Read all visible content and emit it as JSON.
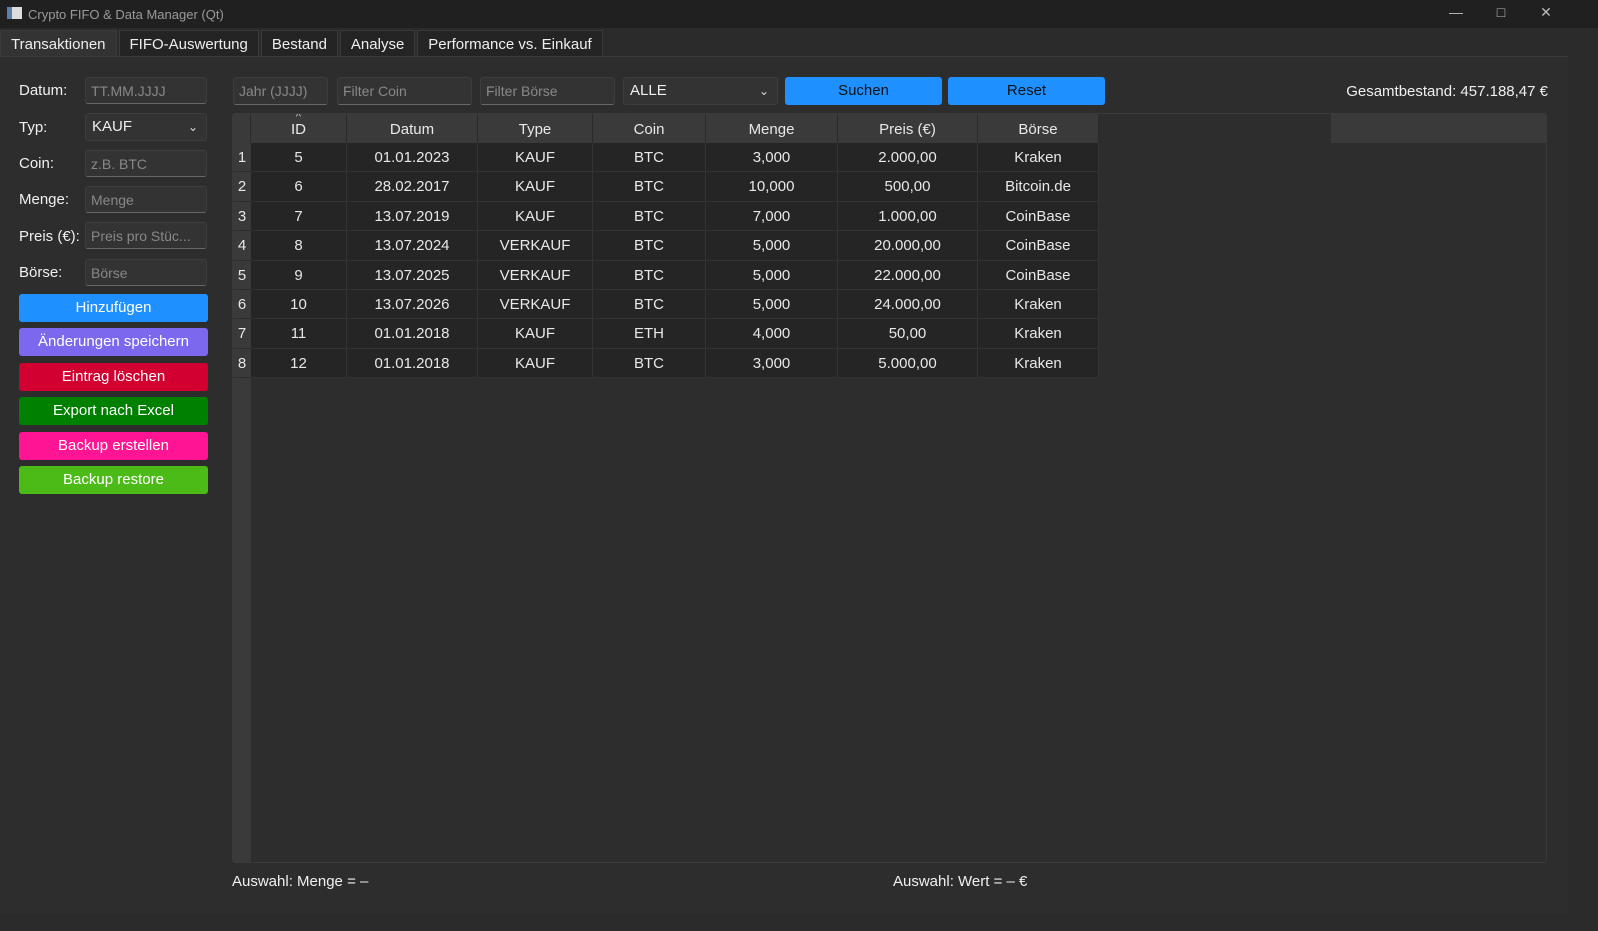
{
  "window": {
    "title": "Crypto FIFO & Data Manager (Qt)"
  },
  "tabs": [
    {
      "label": "Transaktionen"
    },
    {
      "label": "FIFO-Auswertung"
    },
    {
      "label": "Bestand"
    },
    {
      "label": "Analyse"
    },
    {
      "label": "Performance vs. Einkauf"
    }
  ],
  "form": {
    "datum": {
      "label": "Datum:",
      "placeholder": "TT.MM.JJJJ"
    },
    "typ": {
      "label": "Typ:",
      "value": "KAUF"
    },
    "coin": {
      "label": "Coin:",
      "placeholder": "z.B. BTC"
    },
    "menge": {
      "label": "Menge:",
      "placeholder": "Menge"
    },
    "preis": {
      "label": "Preis (€):",
      "placeholder": "Preis pro Stüc..."
    },
    "boerse": {
      "label": "Börse:",
      "placeholder": "Börse"
    }
  },
  "buttons": [
    {
      "label": "Hinzufügen",
      "color": "#1e90ff"
    },
    {
      "label": "Änderungen speichern",
      "color": "#7b68ee"
    },
    {
      "label": "Eintrag löschen",
      "color": "#d10030"
    },
    {
      "label": "Export nach Excel",
      "color": "#008000"
    },
    {
      "label": "Backup erstellen",
      "color": "#ff1493"
    },
    {
      "label": "Backup restore",
      "color": "#4cbb17"
    }
  ],
  "filters": {
    "jahr": "Jahr (JJJJ)",
    "coin": "Filter Coin",
    "boerse": "Filter Börse",
    "type": "ALLE",
    "search": "Suchen",
    "reset": "Reset"
  },
  "total": "Gesamtbestand: 457.188,47 €",
  "table": {
    "sort_indicator": "^",
    "columns": [
      "ID",
      "Datum",
      "Type",
      "Coin",
      "Menge",
      "Preis (€)",
      "Börse"
    ],
    "rows": [
      [
        "5",
        "01.01.2023",
        "KAUF",
        "BTC",
        "3,000",
        "2.000,00",
        "Kraken"
      ],
      [
        "6",
        "28.02.2017",
        "KAUF",
        "BTC",
        "10,000",
        "500,00",
        "Bitcoin.de"
      ],
      [
        "7",
        "13.07.2019",
        "KAUF",
        "BTC",
        "7,000",
        "1.000,00",
        "CoinBase"
      ],
      [
        "8",
        "13.07.2024",
        "VERKAUF",
        "BTC",
        "5,000",
        "20.000,00",
        "CoinBase"
      ],
      [
        "9",
        "13.07.2025",
        "VERKAUF",
        "BTC",
        "5,000",
        "22.000,00",
        "CoinBase"
      ],
      [
        "10",
        "13.07.2026",
        "VERKAUF",
        "BTC",
        "5,000",
        "24.000,00",
        "Kraken"
      ],
      [
        "11",
        "01.01.2018",
        "KAUF",
        "ETH",
        "4,000",
        "50,00",
        "Kraken"
      ],
      [
        "12",
        "01.01.2018",
        "KAUF",
        "BTC",
        "3,000",
        "5.000,00",
        "Kraken"
      ]
    ]
  },
  "status": {
    "menge": "Auswahl: Menge = –",
    "wert": "Auswahl: Wert = – €"
  }
}
